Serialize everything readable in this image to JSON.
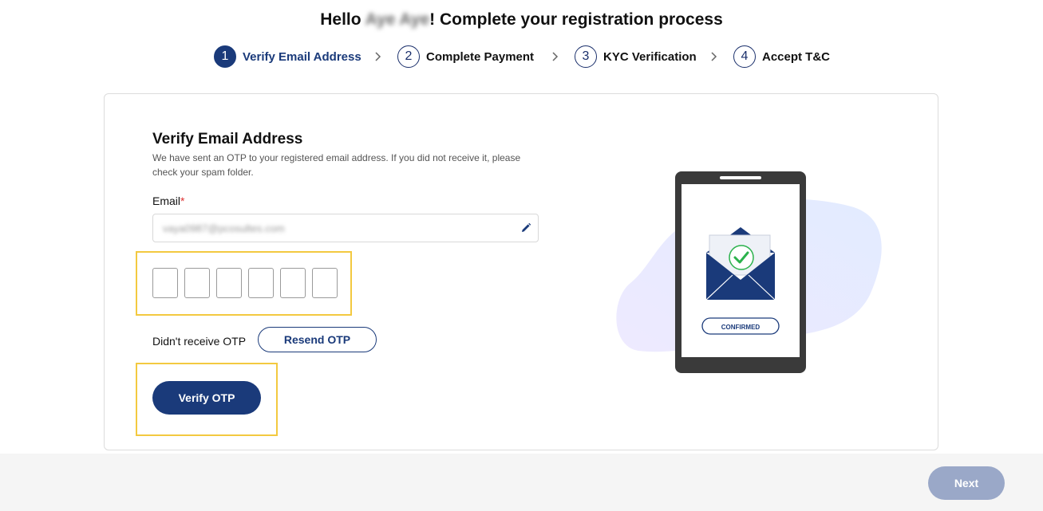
{
  "header": {
    "greeting_prefix": "Hello ",
    "user_name": "Aye Aye",
    "greeting_suffix": "! Complete your registration process"
  },
  "steps": [
    {
      "number": "1",
      "label": "Verify Email Address"
    },
    {
      "number": "2",
      "label": "Complete Payment"
    },
    {
      "number": "3",
      "label": "KYC Verification"
    },
    {
      "number": "4",
      "label": "Accept T&C"
    }
  ],
  "verify": {
    "title": "Verify Email Address",
    "description": "We have sent an OTP to your registered email address. If you did not receive it, please check your spam folder.",
    "email_label": "Email",
    "email_required_mark": "*",
    "email_value": "vaya0987@pcosultes.com",
    "resend_prompt": "Didn't receive OTP",
    "resend_label": "Resend OTP",
    "verify_label": "Verify OTP"
  },
  "illustration": {
    "badge": "CONFIRMED"
  },
  "footer": {
    "next_label": "Next"
  },
  "colors": {
    "primary": "#1a3a7a",
    "highlight": "#f3c940",
    "disabled": "#9aa8c8",
    "check_green": "#2bb24c"
  }
}
